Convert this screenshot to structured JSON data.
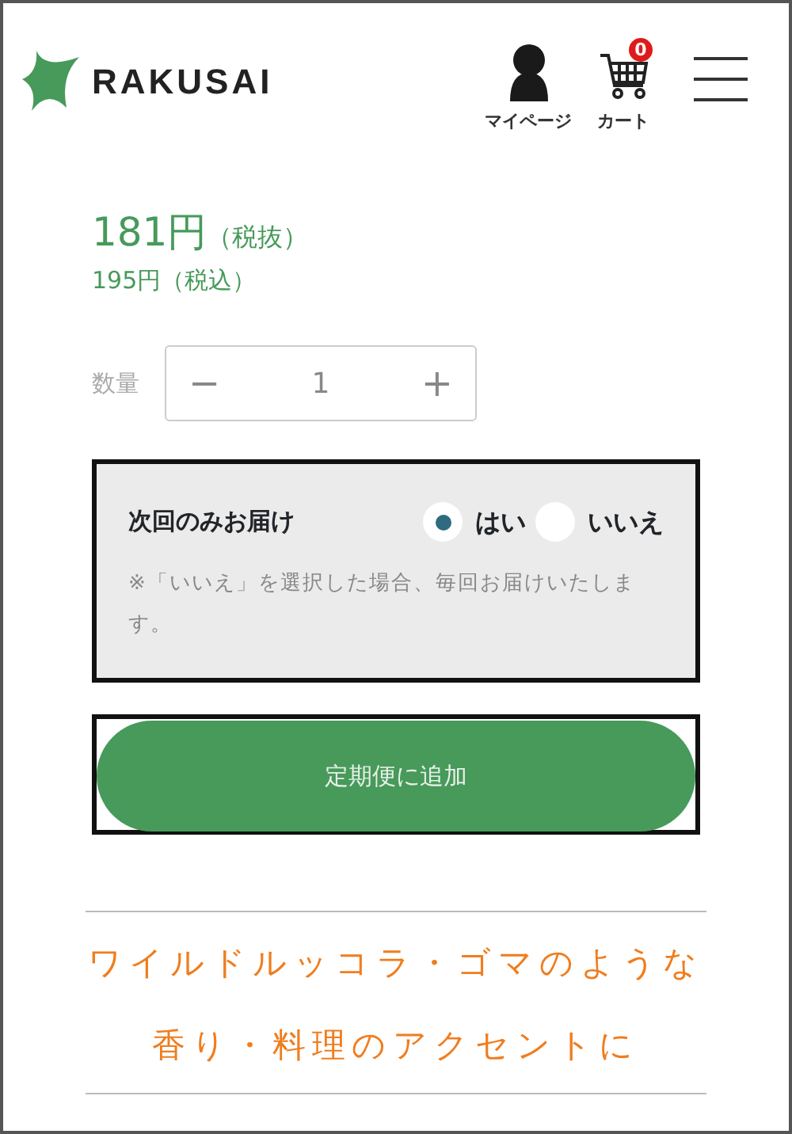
{
  "header": {
    "logo": "RAKUSAI",
    "mypage": "マイページ",
    "cart": "カート",
    "cart_count": "0"
  },
  "price": {
    "ex_tax": "181円",
    "ex_tax_note": "（税抜）",
    "in_tax": "195円（税込）"
  },
  "quantity": {
    "label": "数量",
    "minus": "−",
    "value": "1",
    "plus": "+"
  },
  "delivery": {
    "label": "次回のみお届け",
    "options": [
      {
        "label": "はい",
        "selected": true
      },
      {
        "label": "いいえ",
        "selected": false
      }
    ],
    "note": "※「いいえ」を選択した場合、毎回お届けいたします。"
  },
  "add_button": "定期便に追加",
  "headline": "ワイルドルッコラ・ゴマのような香り・料理のアクセントに"
}
